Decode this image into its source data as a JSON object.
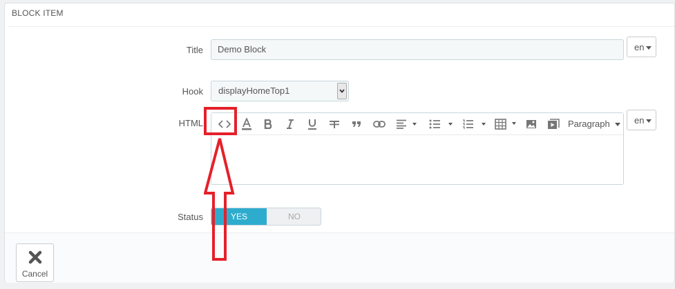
{
  "panel": {
    "heading": "BLOCK ITEM"
  },
  "form": {
    "title": {
      "label": "Title",
      "value": "Demo Block",
      "lang": "en"
    },
    "hook": {
      "label": "Hook",
      "value": "displayHomeTop1"
    },
    "html": {
      "label": "HTML",
      "lang": "en",
      "toolbar": {
        "icons": [
          "code-icon",
          "text-color-icon",
          "bold-icon",
          "italic-icon",
          "underline-icon",
          "strikethrough-icon",
          "blockquote-icon",
          "link-icon",
          "align-left-icon",
          "bullet-list-icon",
          "numbered-list-icon",
          "table-icon",
          "image-icon",
          "media-icon"
        ],
        "format_label": "Paragraph"
      }
    },
    "status": {
      "label": "Status",
      "yes": "YES",
      "no": "NO"
    }
  },
  "footer": {
    "cancel_label": "Cancel"
  },
  "colors": {
    "accent": "#2eacce",
    "annotation": "#e5202a"
  }
}
